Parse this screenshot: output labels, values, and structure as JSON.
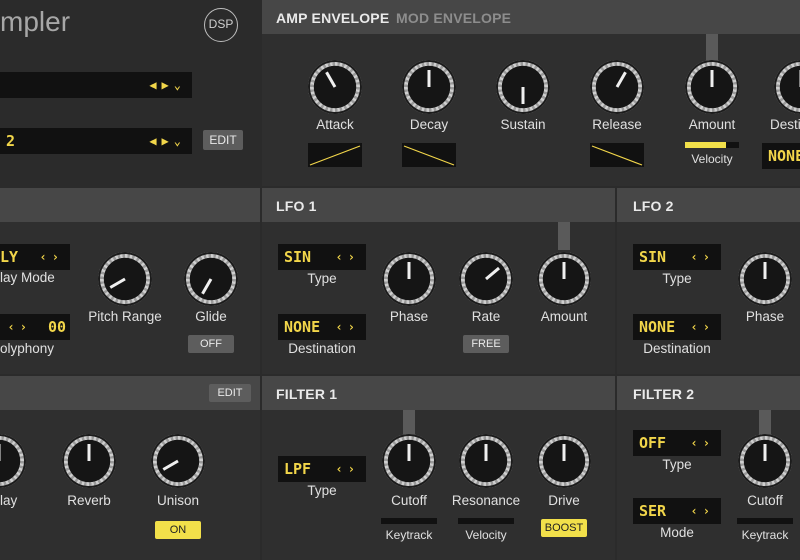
{
  "app": {
    "title_fragment": "mpler",
    "dsp_label": "DSP"
  },
  "top_left": {
    "edit_label": "EDIT",
    "sample_row2_value": "2"
  },
  "amp": {
    "tab_active": "AMP ENVELOPE",
    "tab_inactive": "MOD ENVELOPE",
    "knobs": [
      "Attack",
      "Decay",
      "Sustain",
      "Release",
      "Amount",
      "Desti"
    ],
    "amount_sub": "Velocity",
    "dest_value": "NONE",
    "amount_level": 0.75
  },
  "voice": {
    "mode_value": "LY",
    "play_mode_label": "lay Mode",
    "poly_value": "00",
    "polyphony_label": "olyphony",
    "pitch_range_label": "Pitch Range",
    "glide_label": "Glide",
    "glide_button": "OFF"
  },
  "lfo1": {
    "title": "LFO 1",
    "type_value": "SIN",
    "type_label": "Type",
    "dest_value": "NONE",
    "dest_label": "Destination",
    "phase_label": "Phase",
    "rate_label": "Rate",
    "amount_label": "Amount",
    "free_button": "FREE"
  },
  "lfo2": {
    "title": "LFO 2",
    "type_value": "SIN",
    "type_label": "Type",
    "dest_value": "NONE",
    "dest_label": "Destination",
    "phase_label": "Phase"
  },
  "fx": {
    "edit_label": "EDIT",
    "delay_label": "lay",
    "reverb_label": "Reverb",
    "unison_label": "Unison",
    "unison_button": "ON"
  },
  "filter1": {
    "title": "FILTER 1",
    "type_value": "LPF",
    "type_label": "Type",
    "cutoff_label": "Cutoff",
    "resonance_label": "Resonance",
    "drive_label": "Drive",
    "keytrack_label": "Keytrack",
    "velocity_label": "Velocity",
    "boost_button": "BOOST"
  },
  "filter2": {
    "title": "FILTER 2",
    "type_value": "OFF",
    "type_label": "Type",
    "mode_value": "SER",
    "mode_label": "Mode",
    "cutoff_label": "Cutoff",
    "keytrack_label": "Keytrack"
  },
  "colors": {
    "accent": "#f2e04a",
    "panel": "#2f2f2f",
    "header": "#474747",
    "lcd": "#111111"
  }
}
